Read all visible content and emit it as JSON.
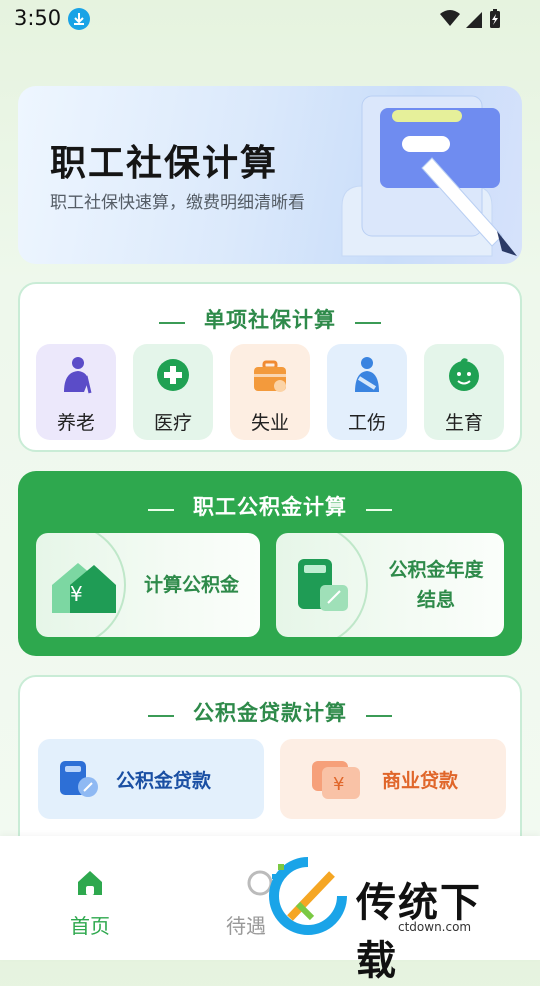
{
  "status_bar": {
    "time": "3:50"
  },
  "banner": {
    "title": "职工社保计算",
    "subtitle": "职工社保快速算，缴费明细清晰看"
  },
  "social_insurance": {
    "title": "单项社保计算",
    "items": [
      {
        "label": "养老",
        "icon": "elderly-icon",
        "bg": "#efeafc",
        "color": "#6b5bd0"
      },
      {
        "label": "医疗",
        "icon": "medical-cross-icon",
        "bg": "#e6f6ec",
        "color": "#1fa153"
      },
      {
        "label": "失业",
        "icon": "briefcase-icon",
        "bg": "#fdf0e4",
        "color": "#f08a32"
      },
      {
        "label": "工伤",
        "icon": "injured-worker-icon",
        "bg": "#e6f0fc",
        "color": "#3a84e0"
      },
      {
        "label": "生育",
        "icon": "baby-icon",
        "bg": "#e6f6ec",
        "color": "#1fa153"
      }
    ]
  },
  "housing_fund": {
    "title": "职工公积金计算",
    "buttons": [
      {
        "label": "计算公积金",
        "icon": "house-yuan-icon"
      },
      {
        "label_line1": "公积金年度",
        "label_line2": "结息",
        "icon": "calculator-icon"
      }
    ]
  },
  "loan": {
    "title": "公积金贷款计算",
    "buttons": [
      {
        "label": "公积金贷款",
        "icon": "loan-calculator-icon",
        "bg": "#e6f2fc",
        "color": "#1a5db8"
      },
      {
        "label": "商业贷款",
        "icon": "yuan-cards-icon",
        "bg": "#fdf0e8",
        "color": "#e0662a"
      }
    ]
  },
  "tabbar": {
    "home": "首页",
    "pending_partial": "待遇"
  },
  "watermark": {
    "brand": "传统下载",
    "domain": "ctdown.com"
  },
  "colors": {
    "primary_green": "#2ea84e",
    "title_green": "#2e8a4a"
  }
}
